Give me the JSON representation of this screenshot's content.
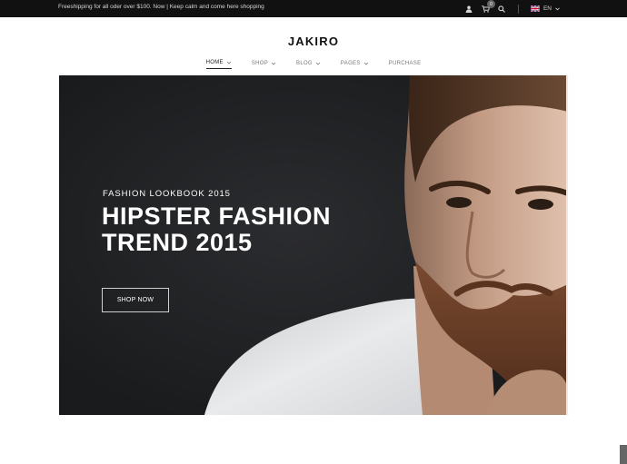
{
  "topbar": {
    "promo": "Freeshipping for all oder over $100. Now | Keep calm and come here shopping",
    "cart_count": "0",
    "language": "EN"
  },
  "header": {
    "logo": "JAKIRO",
    "nav": [
      {
        "label": "HOME",
        "active": true,
        "has_dropdown": true
      },
      {
        "label": "SHOP",
        "active": false,
        "has_dropdown": true
      },
      {
        "label": "BLOG",
        "active": false,
        "has_dropdown": true
      },
      {
        "label": "PAGES",
        "active": false,
        "has_dropdown": true
      },
      {
        "label": "PURCHASE",
        "active": false,
        "has_dropdown": false
      }
    ]
  },
  "hero": {
    "kicker": "FASHION LOOKBOOK 2015",
    "headline_line1": "HIPSTER FASHION",
    "headline_line2": "TREND 2015",
    "button_label": "SHOP NOW",
    "slides_total": 2,
    "active_slide": 1
  },
  "colors": {
    "topbar_bg": "#111111",
    "hero_bg": "#1e1f21",
    "text_light": "#ffffff",
    "logo": "#111111"
  },
  "icons": [
    "user-icon",
    "cart-icon",
    "search-icon",
    "uk-flag-icon",
    "chevron-down-icon"
  ]
}
